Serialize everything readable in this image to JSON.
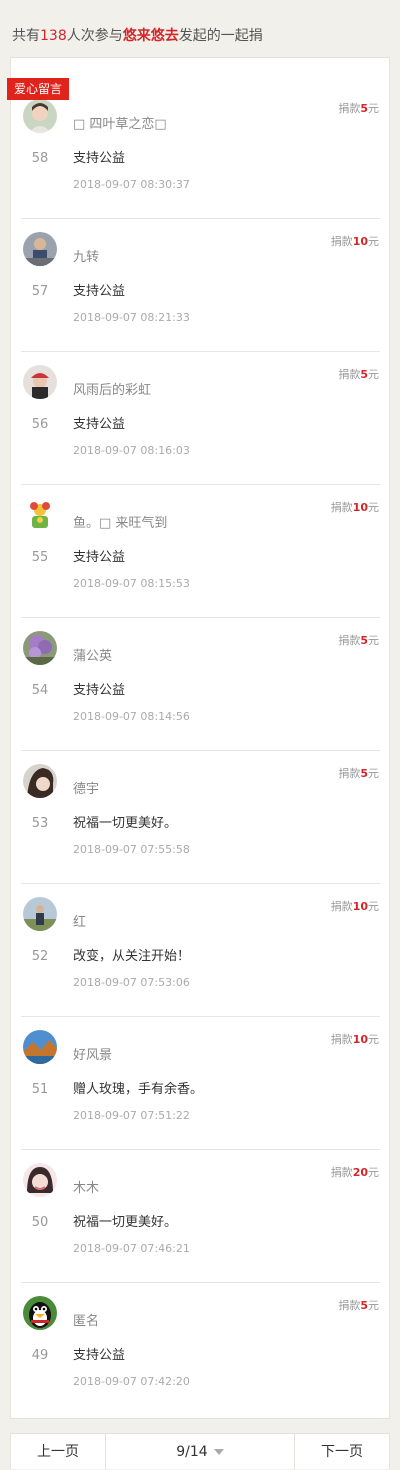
{
  "summary": {
    "prefix": "共有",
    "count": "138",
    "mid": "人次参与",
    "initiator": "悠来悠去",
    "suffix": "发起的一起捐"
  },
  "section_tag": "爱心留言",
  "donation_prefix": "捐款",
  "donation_suffix": "元",
  "entries": [
    {
      "rank": "58",
      "name": "□ 四叶草之恋□",
      "amount": "5",
      "message": "支持公益",
      "time": "2018-09-07 08:30:37",
      "avatar": "girl"
    },
    {
      "rank": "57",
      "name": "九转",
      "amount": "10",
      "message": "支持公益",
      "time": "2018-09-07 08:21:33",
      "avatar": "man"
    },
    {
      "rank": "56",
      "name": "风雨后的彩虹",
      "amount": "5",
      "message": "支持公益",
      "time": "2018-09-07 08:16:03",
      "avatar": "hat"
    },
    {
      "rank": "55",
      "name": "鱼。□ 来旺气到",
      "amount": "10",
      "message": "支持公益",
      "time": "2018-09-07 08:15:53",
      "avatar": "flower"
    },
    {
      "rank": "54",
      "name": "蒲公英",
      "amount": "5",
      "message": "支持公益",
      "time": "2018-09-07 08:14:56",
      "avatar": "lilac"
    },
    {
      "rank": "53",
      "name": "德宇",
      "amount": "5",
      "message": "祝福一切更美好。",
      "time": "2018-09-07 07:55:58",
      "avatar": "hair"
    },
    {
      "rank": "52",
      "name": "红",
      "amount": "10",
      "message": "改变，从关注开始！",
      "time": "2018-09-07 07:53:06",
      "avatar": "outdoor"
    },
    {
      "rank": "51",
      "name": "好风景",
      "amount": "10",
      "message": "赠人玫瑰，手有余香。",
      "time": "2018-09-07 07:51:22",
      "avatar": "landscape"
    },
    {
      "rank": "50",
      "name": "木木",
      "amount": "20",
      "message": "祝福一切更美好。",
      "time": "2018-09-07 07:46:21",
      "avatar": "pink"
    },
    {
      "rank": "49",
      "name": "匿名",
      "amount": "5",
      "message": "支持公益",
      "time": "2018-09-07 07:42:20",
      "avatar": "penguin"
    }
  ],
  "pager": {
    "prev": "上一页",
    "page": "9/14",
    "next": "下一页"
  }
}
